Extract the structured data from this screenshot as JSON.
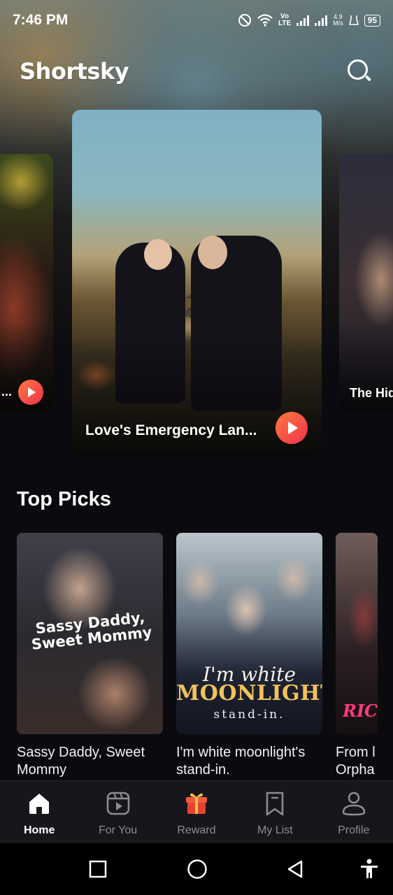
{
  "status_bar": {
    "time": "7:46 PM",
    "volte": "Vo",
    "lte": "LTE",
    "speed_value": "4.9",
    "speed_unit": "M/s",
    "battery": "95"
  },
  "header": {
    "brand": "Shortsky"
  },
  "carousel": {
    "left_title": "...",
    "main_title": "Love's Emergency Lan...",
    "right_title": "The Hid"
  },
  "top_picks": {
    "title": "Top Picks",
    "items": [
      {
        "title": "Sassy Daddy, Sweet Mommy",
        "poster_text": "Sassy Daddy, Sweet Mommy"
      },
      {
        "title": "I'm white moonlight's stand-in.",
        "poster_line1": "I'm white",
        "poster_line2": "MOONLIGHT'S",
        "poster_line3": "stand-in."
      },
      {
        "title": "From l Orpha",
        "poster_text": "RIC"
      }
    ]
  },
  "bottom_nav": {
    "items": [
      {
        "label": "Home",
        "icon": "home-icon",
        "active": true
      },
      {
        "label": "For You",
        "icon": "play-square-icon",
        "active": false
      },
      {
        "label": "Reward",
        "icon": "gift-icon",
        "active": false
      },
      {
        "label": "My List",
        "icon": "bookmark-icon",
        "active": false
      },
      {
        "label": "Profile",
        "icon": "profile-icon",
        "active": false
      }
    ]
  },
  "colors": {
    "accent_gradient_start": "#ff7a3d",
    "accent_gradient_end": "#f0304e",
    "background": "#0b0b0f",
    "nav_inactive": "#8b8b93"
  }
}
